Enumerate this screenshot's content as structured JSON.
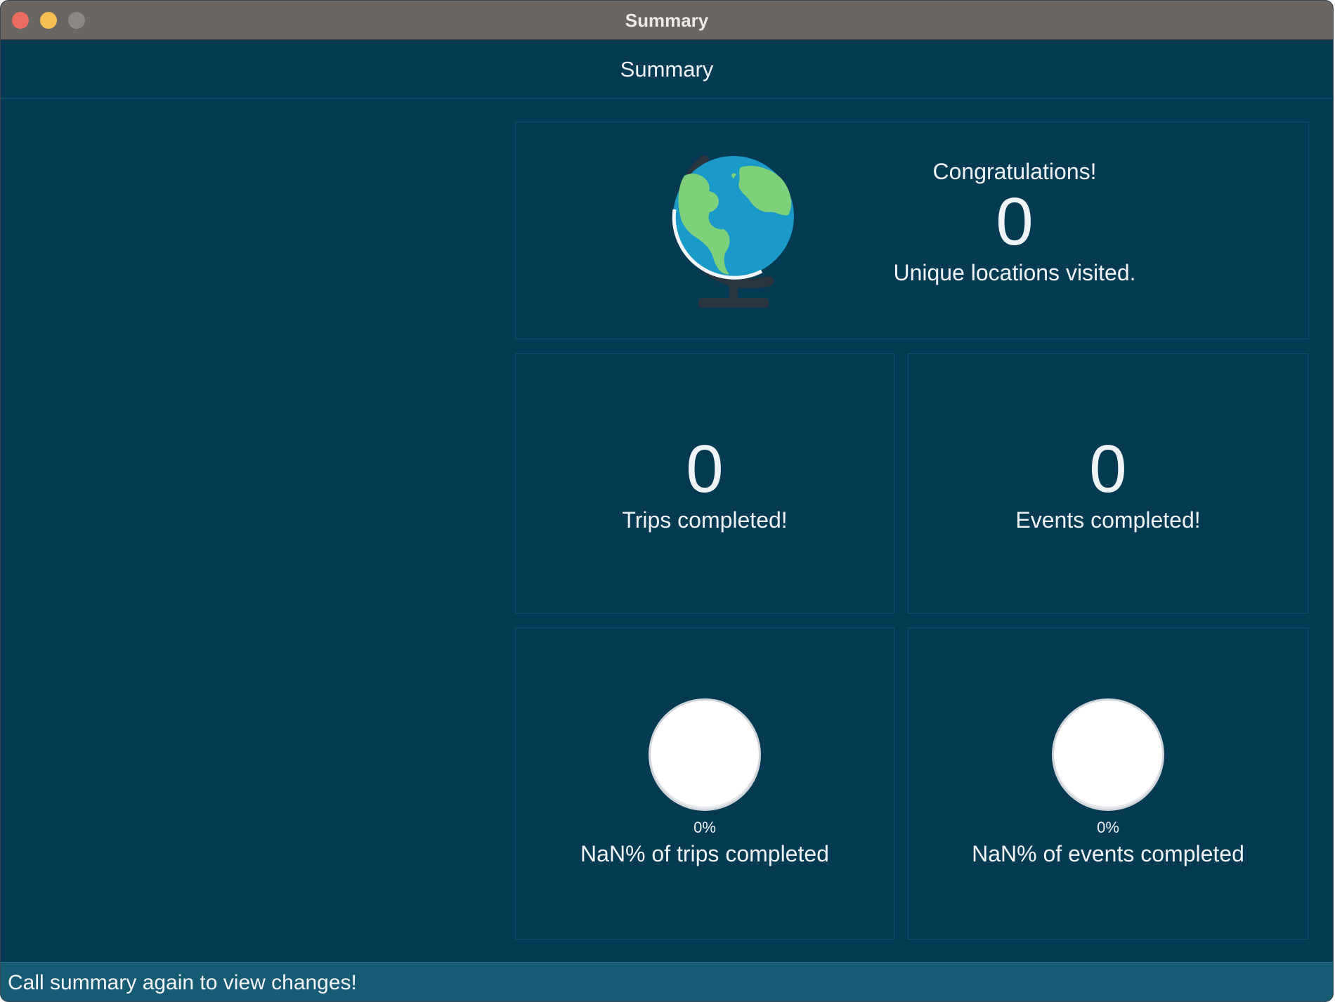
{
  "window": {
    "title": "Summary"
  },
  "header": {
    "title": "Summary"
  },
  "locations": {
    "greeting": "Congratulations!",
    "count": "0",
    "caption": "Unique locations visited."
  },
  "trips": {
    "count": "0",
    "caption": "Trips completed!"
  },
  "events": {
    "count": "0",
    "caption": "Events completed!"
  },
  "trips_progress": {
    "pie_label": "0%",
    "caption": "NaN% of trips completed",
    "fraction": 0
  },
  "events_progress": {
    "pie_label": "0%",
    "caption": "NaN% of events completed",
    "fraction": 0
  },
  "status_bar": {
    "message": "Call summary again to view changes!"
  },
  "icons": {
    "globe": "globe-icon"
  },
  "colors": {
    "background": "#043a52",
    "status_bar": "#175a73",
    "text": "#eef3f6",
    "close": "#ed6a5e",
    "minimize": "#f5bf4f",
    "maximize": "#8b8885"
  }
}
